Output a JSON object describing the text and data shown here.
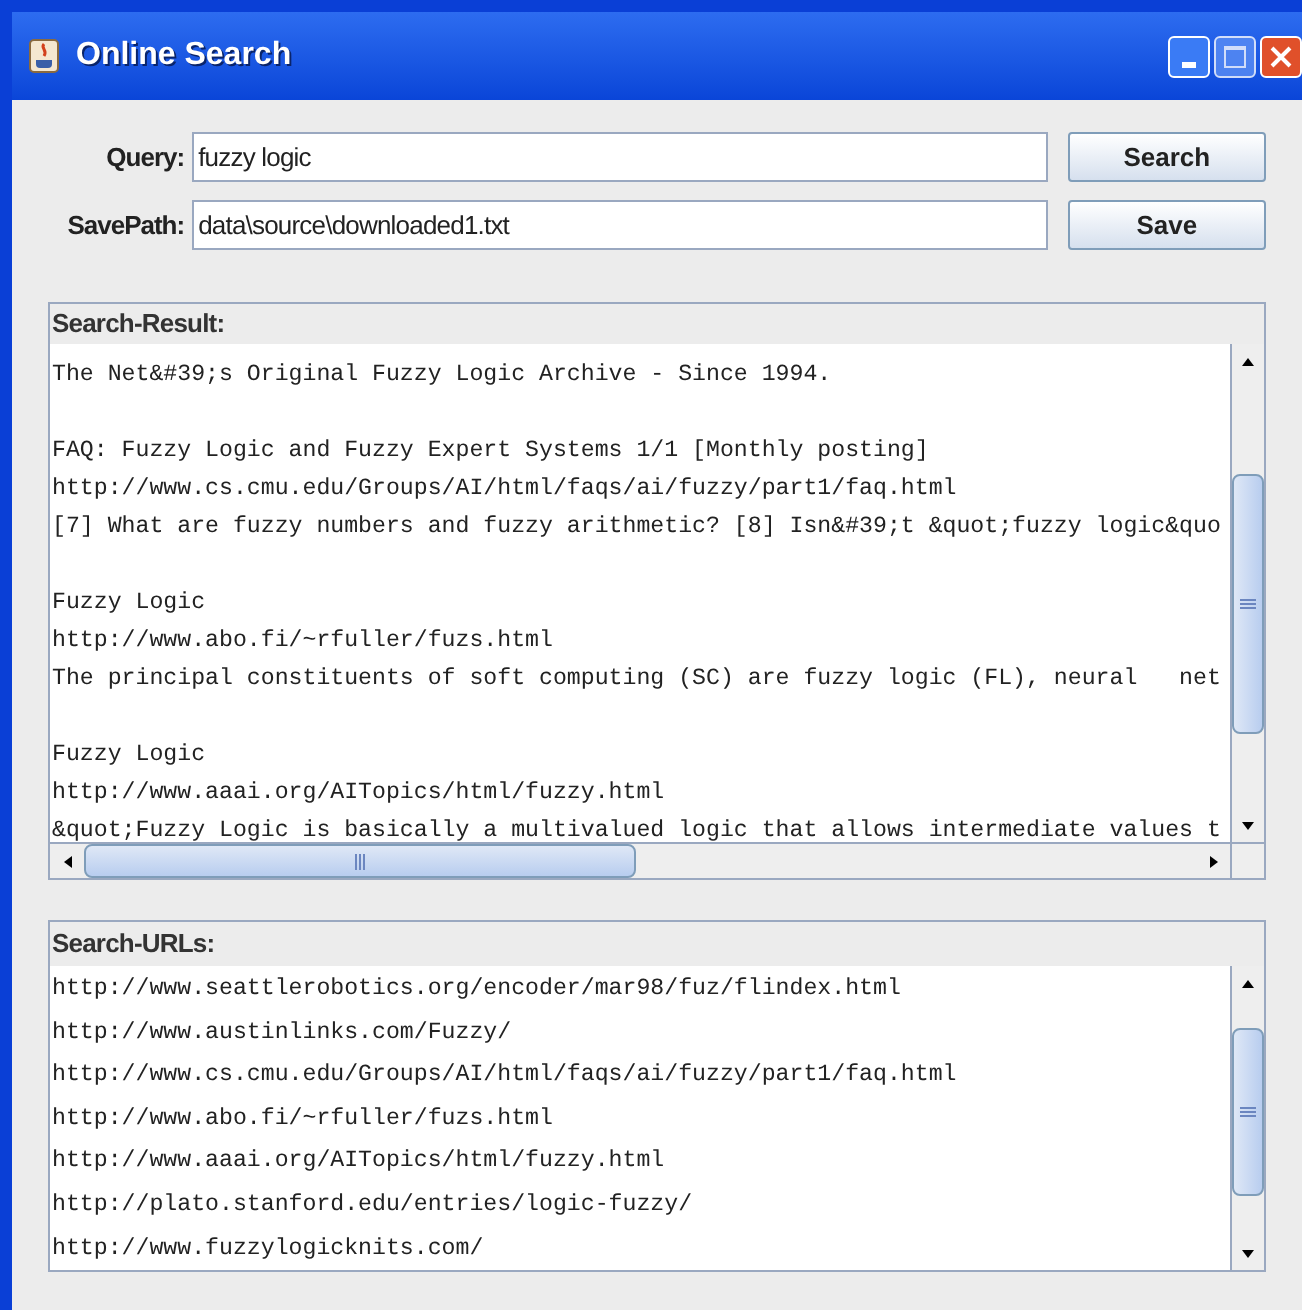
{
  "window": {
    "title": "Online Search"
  },
  "form": [
    {
      "label": "Query:",
      "value": "fuzzy logic",
      "button": "Search"
    },
    {
      "label": "SavePath:",
      "value": "data\\source\\downloaded1.txt",
      "button": "Save"
    }
  ],
  "search_result": {
    "title": "Search-Result:",
    "entries": [
      [
        "The Net&#39;s Original Fuzzy Logic Archive - Since 1994."
      ],
      [
        "FAQ: Fuzzy Logic and Fuzzy Expert Systems 1/1 [Monthly posting]",
        "http://www.cs.cmu.edu/Groups/AI/html/faqs/ai/fuzzy/part1/faq.html",
        "[7] What are fuzzy numbers and fuzzy arithmetic? [8] Isn&#39;t &quot;fuzzy logic&quo"
      ],
      [
        "Fuzzy Logic",
        "http://www.abo.fi/~rfuller/fuzs.html",
        "The principal constituents of soft computing (SC) are fuzzy logic (FL), neural   net"
      ],
      [
        "Fuzzy Logic",
        "http://www.aaai.org/AITopics/html/fuzzy.html",
        "&quot;Fuzzy Logic is basically a multivalued logic that allows intermediate values t"
      ]
    ]
  },
  "search_urls": {
    "title": "Search-URLs:",
    "items": [
      "http://www.seattlerobotics.org/encoder/mar98/fuz/flindex.html",
      "http://www.austinlinks.com/Fuzzy/",
      "http://www.cs.cmu.edu/Groups/AI/html/faqs/ai/fuzzy/part1/faq.html",
      "http://www.abo.fi/~rfuller/fuzs.html",
      "http://www.aaai.org/AITopics/html/fuzzy.html",
      "http://plato.stanford.edu/entries/logic-fuzzy/",
      "http://www.fuzzylogicknits.com/"
    ]
  }
}
